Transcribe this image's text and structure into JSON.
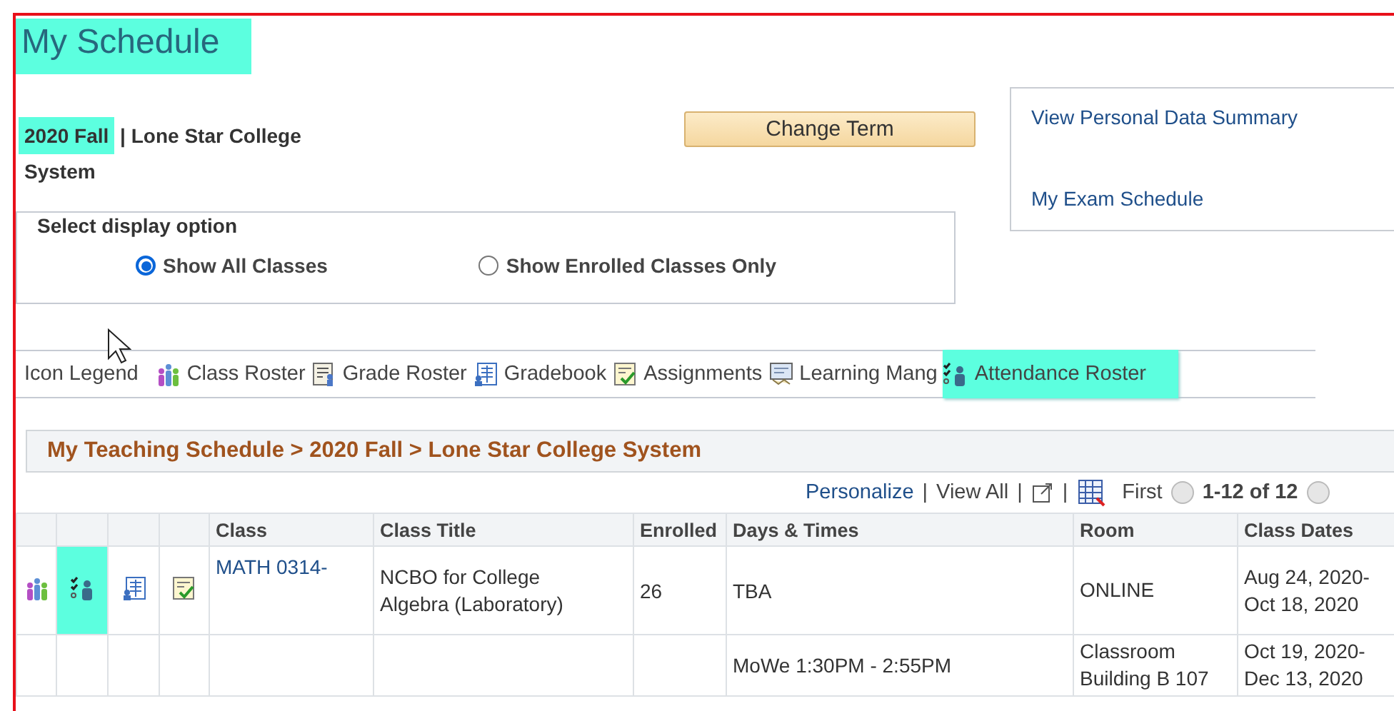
{
  "page_title": {
    "text": "My Schedule",
    "highlighted": true
  },
  "term": {
    "term": "2020 Fall",
    "highlighted": true,
    "separator": "|",
    "institution": "Lone Star College System"
  },
  "change_term_button": "Change Term",
  "links": [
    "View Personal Data Summary",
    "My Exam Schedule"
  ],
  "display_option": {
    "legend": "Select display option",
    "options": [
      {
        "label": "Show All Classes",
        "selected": true
      },
      {
        "label": "Show Enrolled Classes Only",
        "selected": false
      }
    ]
  },
  "icon_legend": {
    "label": "Icon Legend",
    "items": [
      {
        "kind": "class-roster",
        "label": "Class Roster",
        "highlighted": false
      },
      {
        "kind": "grade-roster",
        "label": "Grade Roster",
        "highlighted": false
      },
      {
        "kind": "gradebook",
        "label": "Gradebook",
        "highlighted": false
      },
      {
        "kind": "assignments",
        "label": "Assignments",
        "highlighted": false
      },
      {
        "kind": "learning",
        "label": "Learning Mang",
        "highlighted": false
      },
      {
        "kind": "attendance",
        "label": "Attendance Roster",
        "highlighted": true
      }
    ]
  },
  "grid": {
    "title": "My Teaching Schedule > 2020 Fall > Lone Star College System",
    "toolbar": {
      "personalize": "Personalize",
      "separators": [
        "|",
        "|",
        "|"
      ],
      "view_all": "View All",
      "first": "First",
      "range": "1-12 of 12"
    },
    "columns": [
      "Class",
      "Class Title",
      "Enrolled",
      "Days & Times",
      "Room",
      "Class Dates"
    ],
    "rows": [
      {
        "icons": [
          {
            "kind": "class-roster",
            "highlighted": false
          },
          {
            "kind": "attendance",
            "highlighted": true
          },
          {
            "kind": "gradebook",
            "highlighted": false
          },
          {
            "kind": "assignments",
            "highlighted": false
          }
        ],
        "class": "MATH 0314-",
        "title": "NCBO for College Algebra (Laboratory)",
        "enrolled": "26",
        "days_times": "TBA",
        "room": "ONLINE",
        "dates": "Aug 24, 2020- Oct 18, 2020"
      },
      {
        "days_times": "MoWe 1:30PM - 2:55PM",
        "room": "Classroom Building B 107",
        "dates": "Oct 19, 2020- Dec 13, 2020"
      }
    ]
  }
}
